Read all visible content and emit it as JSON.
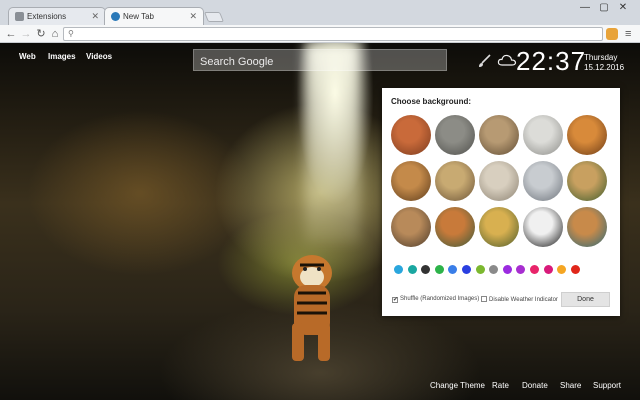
{
  "browser": {
    "tabs": [
      {
        "label": "Extensions",
        "active": false
      },
      {
        "label": "New Tab",
        "active": true
      }
    ],
    "window_controls": {
      "minimize": "—",
      "maximize": "▢",
      "close": "✕"
    },
    "address": {
      "value": "",
      "placeholder": ""
    }
  },
  "page": {
    "top_links": [
      "Web",
      "Images",
      "Videos"
    ],
    "search": {
      "placeholder": "Search Google",
      "value": ""
    },
    "clock": {
      "time": "22:37",
      "day": "Thursday",
      "date": "15.12.2016"
    }
  },
  "background_panel": {
    "title": "Choose background:",
    "thumbnails": [
      {
        "icon": "lion-thumbnail",
        "colors": [
          "#c96a3a",
          "#7a3a1e"
        ]
      },
      {
        "icon": "elephant-thumbnail",
        "colors": [
          "#8c8c86",
          "#4e4e4a"
        ]
      },
      {
        "icon": "lion-mane-thumbnail",
        "colors": [
          "#b79a73",
          "#5e4a32"
        ]
      },
      {
        "icon": "white-tiger-thumbnail",
        "colors": [
          "#dcdcd8",
          "#8a8a86"
        ]
      },
      {
        "icon": "tiger-face-thumbnail",
        "colors": [
          "#d88a3a",
          "#6a3a16"
        ]
      },
      {
        "icon": "tiger-roar-thumbnail",
        "colors": [
          "#c48a4a",
          "#5a3a1a"
        ]
      },
      {
        "icon": "leopard-thumbnail",
        "colors": [
          "#c8aa72",
          "#6a5236"
        ]
      },
      {
        "icon": "white-lion-thumbnail",
        "colors": [
          "#d8cfbf",
          "#8a8070"
        ]
      },
      {
        "icon": "snow-leopard-thumbnail",
        "colors": [
          "#c8ccd0",
          "#6a7078"
        ]
      },
      {
        "icon": "lioness-thumbnail",
        "colors": [
          "#c8a060",
          "#3a5a2a"
        ]
      },
      {
        "icon": "tiger-cub-thumbnail",
        "colors": [
          "#b88a5a",
          "#4a3a2a"
        ]
      },
      {
        "icon": "tiger-river-thumbnail",
        "colors": [
          "#c87a3a",
          "#3a5a3a"
        ]
      },
      {
        "icon": "tiger-grass-thumbnail",
        "colors": [
          "#d8b050",
          "#4a5a2a"
        ]
      },
      {
        "icon": "black-tiger-thumbnail",
        "colors": [
          "#f0f0f0",
          "#111111"
        ]
      },
      {
        "icon": "tiger-water-thumbnail",
        "colors": [
          "#c88a4a",
          "#2a6a7a"
        ]
      }
    ],
    "swatches": [
      "#2aa6dd",
      "#1aa7a1",
      "#333333",
      "#2db34a",
      "#3a7ee8",
      "#2a3fe0",
      "#7cb82f",
      "#8a8a8a",
      "#9b2be0",
      "#a72ed0",
      "#e8246a",
      "#d81a7a",
      "#f5a623",
      "#e0261a"
    ],
    "shuffle": {
      "label": "Shuffle (Randomized Images)",
      "checked": true
    },
    "disable_weather": {
      "label": "Disable Weather Indicator",
      "checked": false
    },
    "done_label": "Done"
  },
  "footer": {
    "links": [
      "Change Theme",
      "Rate",
      "Donate",
      "Share",
      "Support"
    ]
  }
}
